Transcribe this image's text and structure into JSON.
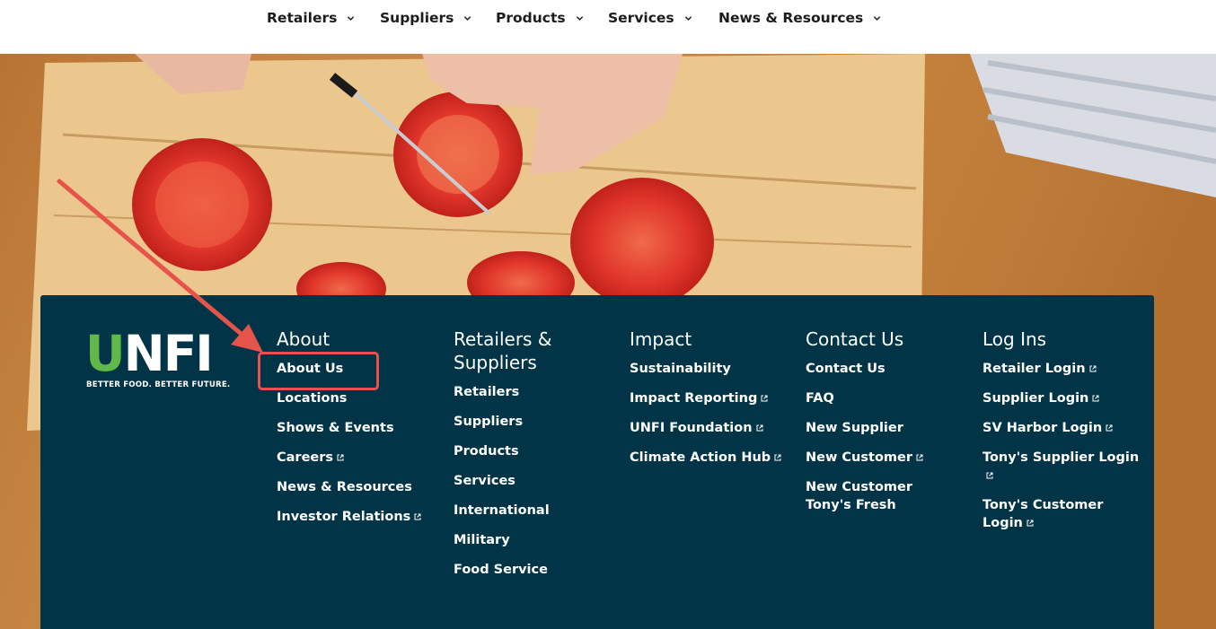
{
  "topnav": {
    "items": [
      {
        "label": "Retailers"
      },
      {
        "label": "Suppliers"
      },
      {
        "label": "Products"
      },
      {
        "label": "Services"
      },
      {
        "label": "News & Resources"
      }
    ]
  },
  "logo": {
    "word_u": "U",
    "word_rest": "NFI",
    "tagline": "BETTER FOOD. BETTER FUTURE."
  },
  "footer": {
    "columns": [
      {
        "title": "About",
        "links": [
          {
            "label": "About Us",
            "external": false
          },
          {
            "label": "Locations",
            "external": false
          },
          {
            "label": "Shows & Events",
            "external": false
          },
          {
            "label": "Careers",
            "external": true
          },
          {
            "label": "News & Resources",
            "external": false
          },
          {
            "label": "Investor Relations",
            "external": true
          }
        ]
      },
      {
        "title": "Retailers & Suppliers",
        "links": [
          {
            "label": "Retailers",
            "external": false
          },
          {
            "label": "Suppliers",
            "external": false
          },
          {
            "label": "Products",
            "external": false
          },
          {
            "label": "Services",
            "external": false
          },
          {
            "label": "International",
            "external": false
          },
          {
            "label": "Military",
            "external": false
          },
          {
            "label": "Food Service",
            "external": false
          }
        ]
      },
      {
        "title": "Impact",
        "links": [
          {
            "label": "Sustainability",
            "external": false
          },
          {
            "label": "Impact Reporting",
            "external": true
          },
          {
            "label": "UNFI Foundation",
            "external": true
          },
          {
            "label": "Climate Action Hub",
            "external": true
          }
        ]
      },
      {
        "title": "Contact Us",
        "links": [
          {
            "label": "Contact Us",
            "external": false
          },
          {
            "label": "FAQ",
            "external": false
          },
          {
            "label": "New Supplier",
            "external": false
          },
          {
            "label": "New Customer",
            "external": true
          },
          {
            "label": "New Customer Tony's Fresh",
            "external": false
          }
        ]
      },
      {
        "title": "Log Ins",
        "links": [
          {
            "label": "Retailer Login",
            "external": true
          },
          {
            "label": "Supplier Login",
            "external": true
          },
          {
            "label": "SV Harbor Login",
            "external": true
          },
          {
            "label": "Tony's Supplier Login",
            "external": true
          },
          {
            "label": "Tony's Customer Login",
            "external": true
          }
        ]
      }
    ]
  },
  "colors": {
    "footer_bg": "#003446",
    "brand_green": "#5fb847",
    "annotation_red": "#e5534b"
  },
  "icons": {
    "nav_dropdown": "chevron-down-icon",
    "external_link": "external-link-icon"
  }
}
